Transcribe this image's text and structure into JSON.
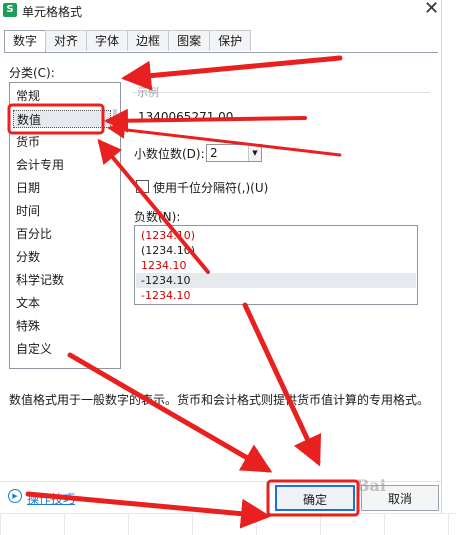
{
  "window": {
    "title": "单元格格式",
    "app_icon_letter": "S",
    "close_glyph": "✕"
  },
  "tabs": [
    "数字",
    "对齐",
    "字体",
    "边框",
    "图案",
    "保护"
  ],
  "category": {
    "label": "分类(C):",
    "items": [
      "常规",
      "数值",
      "货币",
      "会计专用",
      "日期",
      "时间",
      "百分比",
      "分数",
      "科学记数",
      "文本",
      "特殊",
      "自定义"
    ],
    "selected": "数值"
  },
  "sample": {
    "label": "示例",
    "value": "1340065271.00"
  },
  "decimals": {
    "label": "小数位数(D):",
    "value": "2"
  },
  "thousands": {
    "label": "使用千位分隔符(,)(U)"
  },
  "negatives": {
    "label": "负数(N):",
    "items": [
      {
        "text": "(1234.10)",
        "color": "#d40000"
      },
      {
        "text": "(1234.10)",
        "color": "#1a1a1a"
      },
      {
        "text": "1234.10",
        "color": "#d40000"
      },
      {
        "text": "-1234.10",
        "color": "#1a1a1a"
      },
      {
        "text": "-1234.10",
        "color": "#d40000"
      }
    ],
    "selected_index": 3
  },
  "description": "数值格式用于一般数字的表示。货币和会计格式则提供货币值计算的专用格式。",
  "footer": {
    "tips_label": "操作技巧",
    "ok_label": "确定",
    "cancel_label": "取消"
  },
  "annotation_color": "#e8201f",
  "watermark": "Bai"
}
